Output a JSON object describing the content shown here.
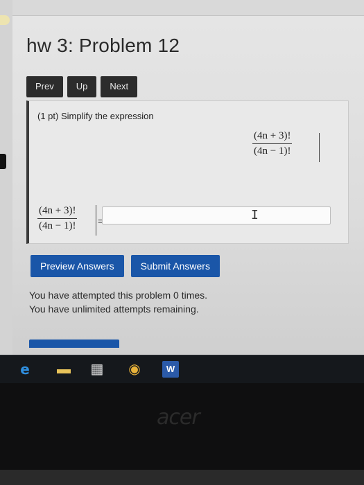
{
  "page": {
    "title": "hw 3: Problem 12"
  },
  "nav": {
    "prev": "Prev",
    "up": "Up",
    "next": "Next"
  },
  "problem": {
    "prompt": "(1 pt) Simplify the expression",
    "expression": {
      "numerator": "(4n + 3)!",
      "denominator": "(4n − 1)!"
    },
    "answer_label": {
      "numerator": "(4n + 3)!",
      "denominator": "(4n − 1)!",
      "equals": "="
    },
    "answer_value": "",
    "answer_placeholder": "",
    "cursor_glyph": "I"
  },
  "actions": {
    "preview": "Preview Answers",
    "submit": "Submit Answers"
  },
  "status": {
    "attempts": "You have attempted this problem 0 times.",
    "remaining": "You have unlimited attempts remaining."
  },
  "taskbar": {
    "icons": [
      "edge-icon",
      "file-explorer-icon",
      "store-icon",
      "chrome-icon",
      "word-icon"
    ],
    "glyphs": {
      "edge": "e",
      "explorer": "▬",
      "store": "▦",
      "chrome": "◉",
      "word": "W"
    }
  },
  "device": {
    "brand": "acer"
  },
  "colors": {
    "button_blue": "#1a56a8",
    "nav_dark": "#2c2c2c"
  }
}
